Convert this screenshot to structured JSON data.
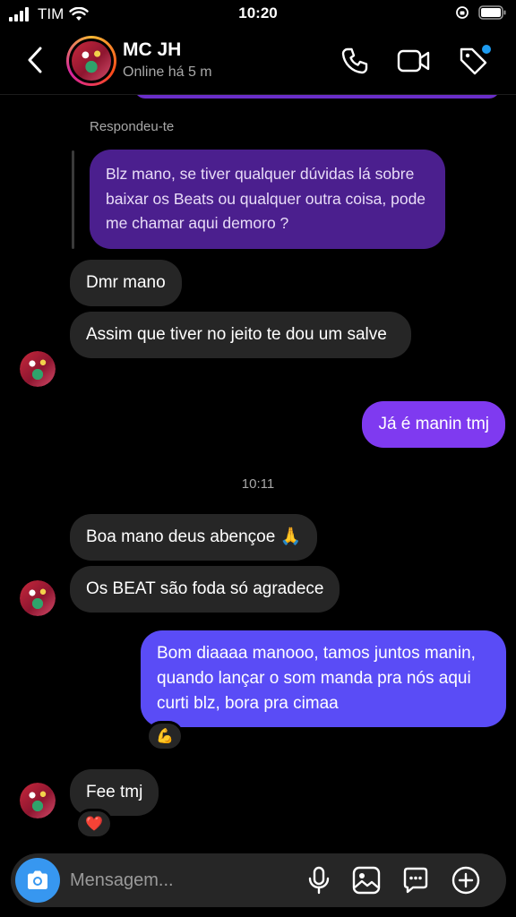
{
  "status_bar": {
    "carrier": "TIM",
    "time": "10:20"
  },
  "header": {
    "contact_name": "MC JH",
    "contact_status": "Online há 5 m",
    "icons": [
      "back-icon",
      "phone-icon",
      "video-icon",
      "tag-icon"
    ]
  },
  "chat": {
    "replied_label": "Respondeu-te",
    "quoted_message": "Blz mano, se tiver qualquer dúvidas lá sobre baixar os Beats ou qualquer outra coisa, pode me chamar aqui demoro ?",
    "messages": [
      {
        "from": "contact",
        "text": "Dmr mano"
      },
      {
        "from": "contact",
        "text": "Assim que tiver no jeito te dou um salve"
      },
      {
        "from": "me",
        "text": "Já é manin tmj"
      },
      {
        "timestamp": "10:11"
      },
      {
        "from": "contact",
        "text": "Boa mano deus abençoe 🙏"
      },
      {
        "from": "contact",
        "text": "Os BEAT são foda só agradece"
      },
      {
        "from": "me",
        "text": "Bom diaaaa manooo, tamos juntos manin, quando lançar o som manda pra nós aqui curti blz, bora pra cimaa",
        "reaction": "💪"
      },
      {
        "from": "contact",
        "text": "Fee tmj",
        "reaction": "❤️"
      }
    ]
  },
  "composer": {
    "placeholder": "Mensagem...",
    "icons": [
      "camera-icon",
      "microphone-icon",
      "gallery-icon",
      "sticker-icon",
      "add-icon"
    ]
  },
  "colors": {
    "background": "#000000",
    "incoming_bubble": "#262626",
    "outgoing_purple": "#7f3af0",
    "outgoing_blue": "#5a4cf6",
    "accent_blue": "#3797f0"
  }
}
